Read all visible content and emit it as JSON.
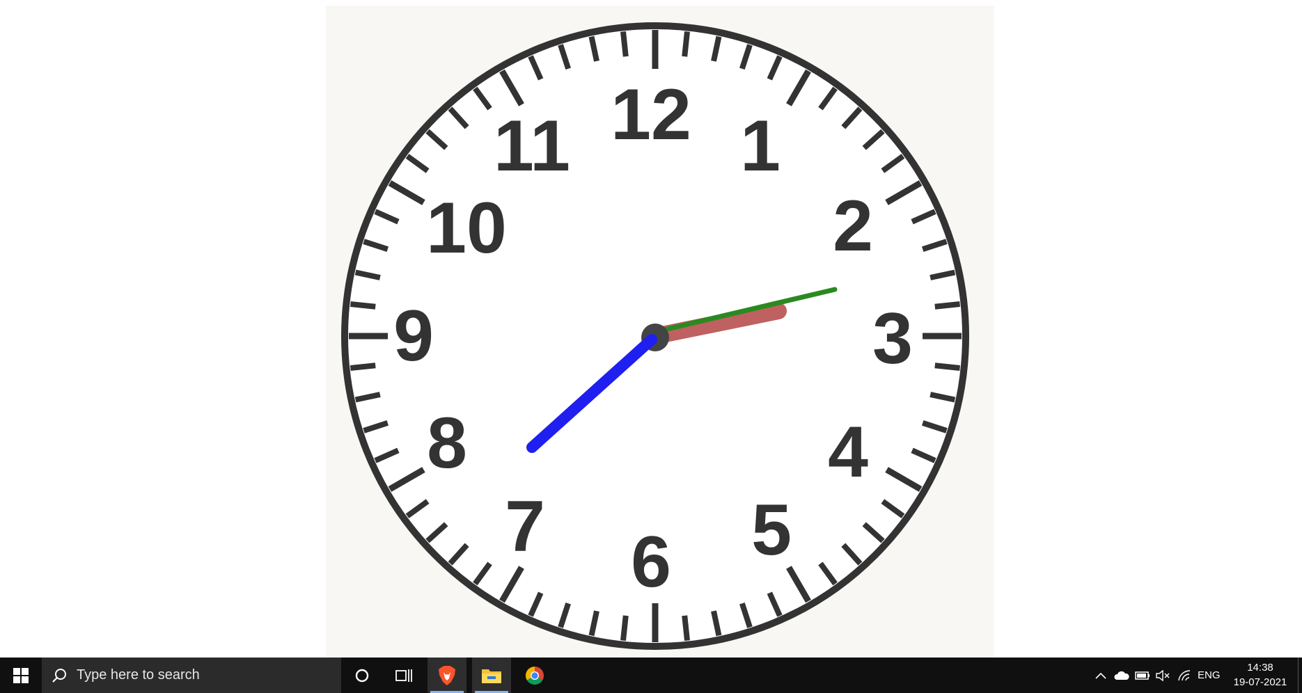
{
  "clock": {
    "numerals": [
      "12",
      "1",
      "2",
      "3",
      "4",
      "5",
      "6",
      "7",
      "8",
      "9",
      "10",
      "11"
    ],
    "hands": {
      "hour_color": "#b8504f",
      "minute_color": "#2a8a20",
      "blue_color": "#1f1ff0"
    }
  },
  "taskbar": {
    "search_placeholder": "Type here to search",
    "apps": [
      "brave",
      "file-explorer",
      "chrome"
    ],
    "language": "ENG",
    "time": "14:38",
    "date": "19-07-2021"
  }
}
